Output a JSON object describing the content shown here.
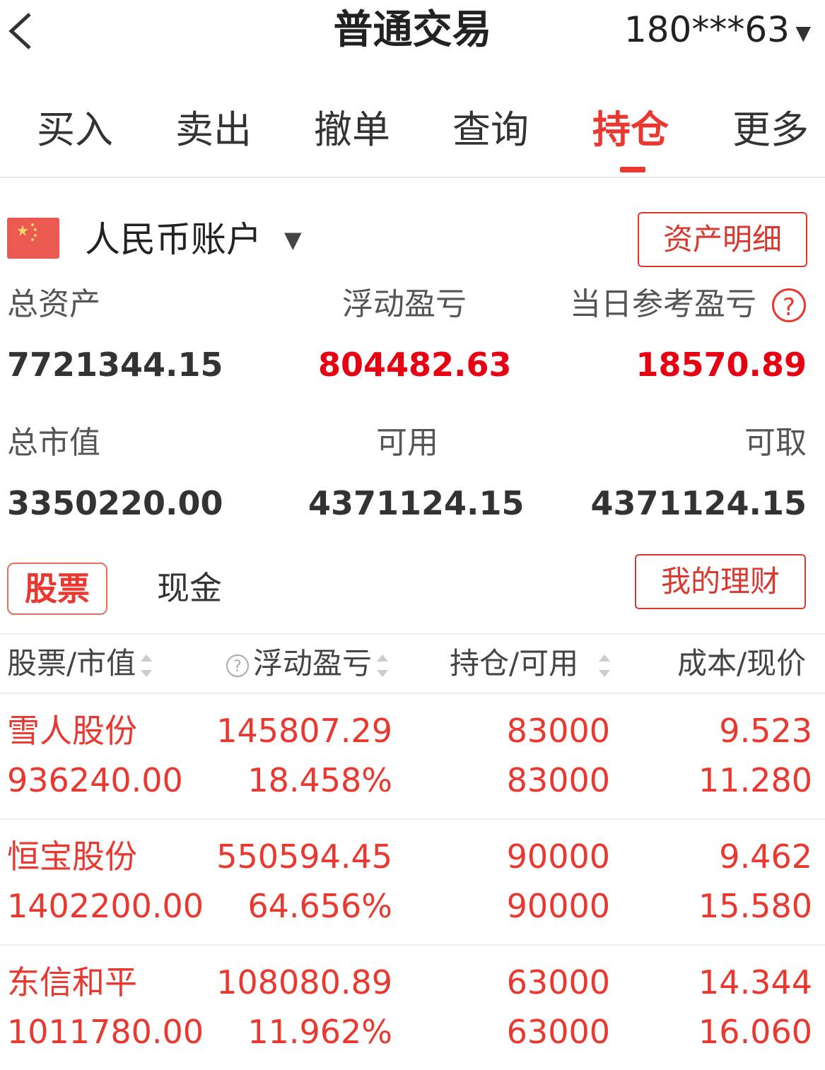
{
  "header": {
    "title": "普通交易",
    "account_masked": "180***63",
    "caret": "▼"
  },
  "tabs": [
    "买入",
    "卖出",
    "撤单",
    "查询",
    "持仓",
    "更多"
  ],
  "active_tab": "持仓",
  "account": {
    "currency_label": "人民币账户",
    "caret": "▼",
    "asset_detail_button": "资产明细"
  },
  "stats": {
    "total_assets_label": "总资产",
    "total_assets": "7721344.15",
    "floating_pl_label": "浮动盈亏",
    "floating_pl": "804482.63",
    "daily_pl_label": "当日参考盈亏",
    "daily_pl": "18570.89",
    "help_icon": "?",
    "market_value_label": "总市值",
    "market_value": "3350220.00",
    "available_label": "可用",
    "available": "4371124.15",
    "withdrawable_label": "可取",
    "withdrawable": "4371124.15"
  },
  "segment": {
    "stock": "股票",
    "cash": "现金",
    "finance_button": "我的理财"
  },
  "table": {
    "headers": [
      "股票/市值",
      "浮动盈亏",
      "持仓/可用",
      "成本/现价"
    ],
    "header_help": "?",
    "rows": [
      {
        "name": "雪人股份",
        "market_value": "936240.00",
        "pl": "145807.29",
        "pl_pct": "18.458%",
        "position": "83000",
        "available": "83000",
        "cost": "9.523",
        "price": "11.280"
      },
      {
        "name": "恒宝股份",
        "market_value": "1402200.00",
        "pl": "550594.45",
        "pl_pct": "64.656%",
        "position": "90000",
        "available": "90000",
        "cost": "9.462",
        "price": "15.580"
      },
      {
        "name": "东信和平",
        "market_value": "1011780.00",
        "pl": "108080.89",
        "pl_pct": "11.962%",
        "position": "63000",
        "available": "63000",
        "cost": "14.344",
        "price": "16.060"
      }
    ]
  },
  "colors": {
    "accent": "#e8382f",
    "profit": "#e60012"
  }
}
